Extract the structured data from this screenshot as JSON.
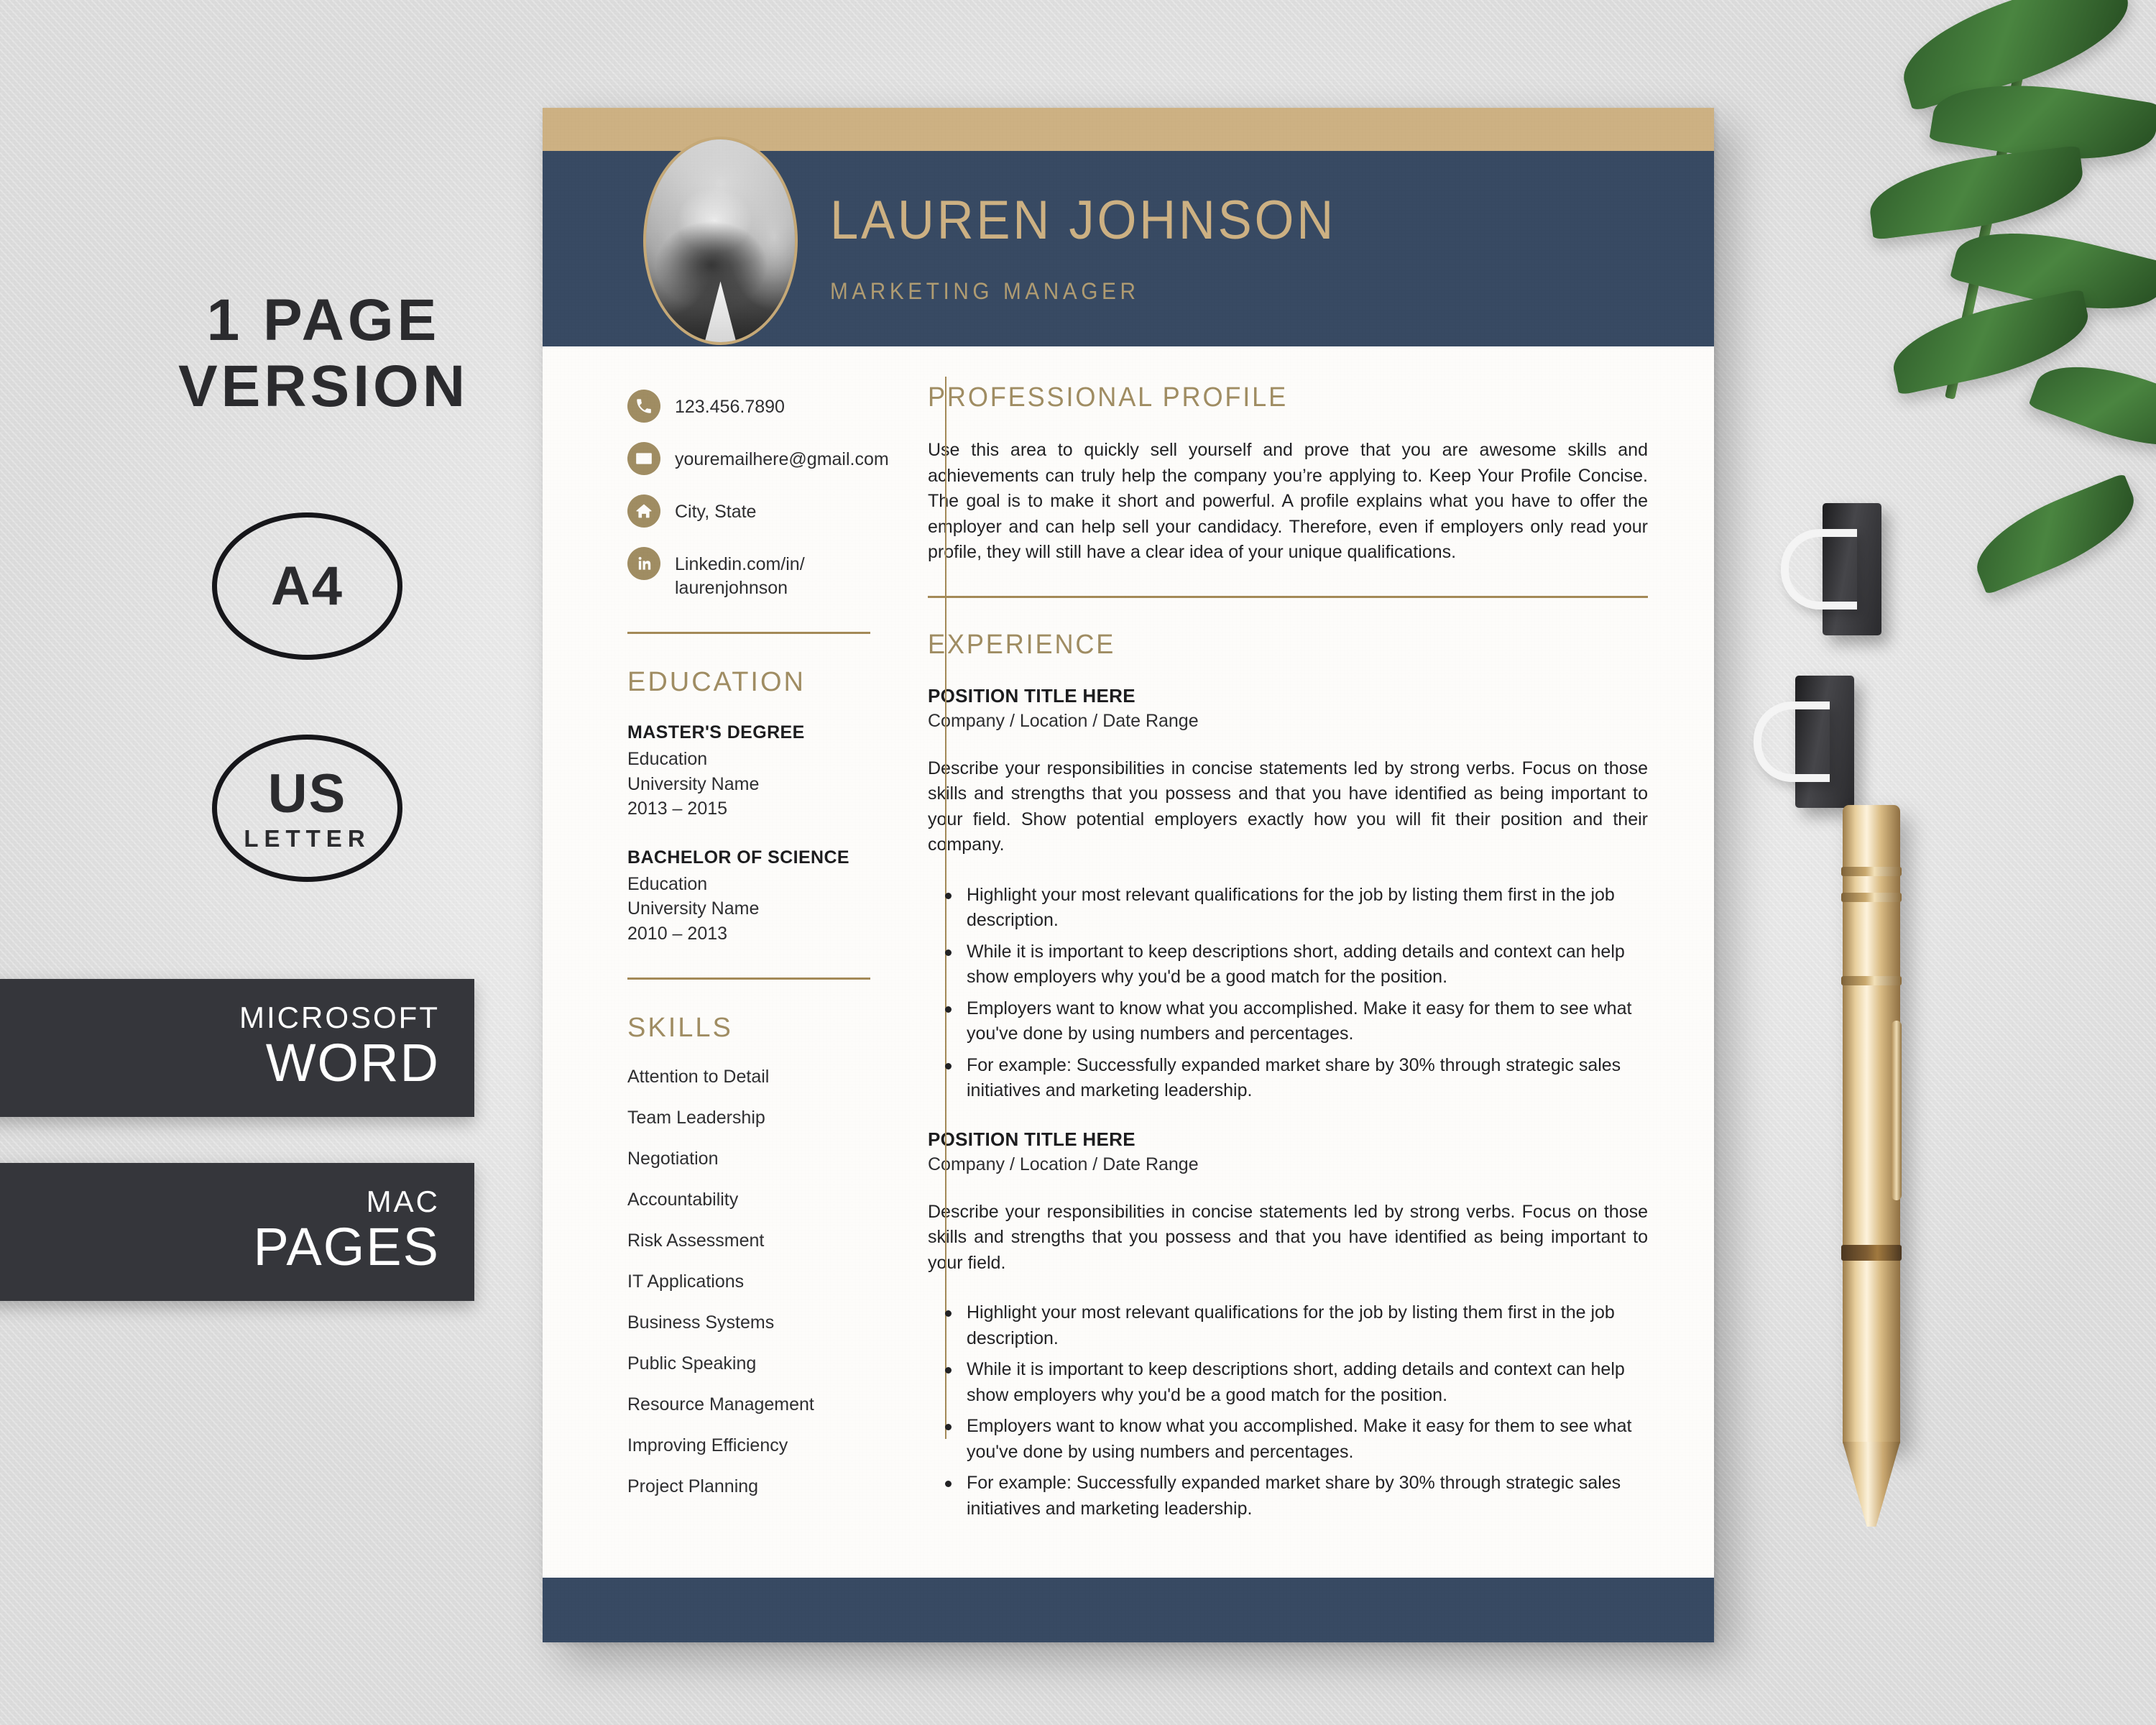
{
  "promo": {
    "title_line1": "1 PAGE",
    "title_line2": "VERSION",
    "badges": [
      {
        "main": "A4",
        "sub": ""
      },
      {
        "main": "US",
        "sub": "LETTER"
      }
    ],
    "format_boxes": [
      {
        "small": "MICROSOFT",
        "big": "WORD"
      },
      {
        "small": "MAC",
        "big": "PAGES"
      }
    ]
  },
  "resume": {
    "name": "LAUREN JOHNSON",
    "role": "MARKETING MANAGER",
    "contacts": [
      {
        "icon": "phone-icon",
        "text": "123.456.7890"
      },
      {
        "icon": "envelope-icon",
        "text": "youremailhere@gmail.com"
      },
      {
        "icon": "home-icon",
        "text": "City, State"
      },
      {
        "icon": "linkedin-icon",
        "text": "Linkedin.com/in/ laurenjohnson"
      }
    ],
    "profile": {
      "heading": "PROFESSIONAL PROFILE",
      "text": "Use this area to quickly sell yourself and prove that you are awesome skills and achievements can truly help the company you’re applying to. Keep Your Profile Concise. The goal is to make it short and powerful. A profile explains what you have to offer the employer and can help sell your candidacy. Therefore, even if employers only read your profile, they will still have a clear idea of your unique qualifications."
    },
    "education": {
      "heading": "EDUCATION",
      "items": [
        {
          "degree": "MASTER'S DEGREE",
          "field": "Education",
          "school": "University Name",
          "dates": "2013 – 2015"
        },
        {
          "degree": "BACHELOR OF SCIENCE",
          "field": "Education",
          "school": "University Name",
          "dates": "2010 – 2013"
        }
      ]
    },
    "skills": {
      "heading": "SKILLS",
      "items": [
        "Attention to Detail",
        "Team Leadership",
        "Negotiation",
        "Accountability",
        "Risk Assessment",
        "IT Applications",
        "Business Systems",
        "Public Speaking",
        "Resource Management",
        "Improving Efficiency",
        "Project Planning"
      ]
    },
    "experience": {
      "heading": "EXPERIENCE",
      "jobs": [
        {
          "title": "POSITION TITLE HERE",
          "meta": "Company / Location / Date Range",
          "description": "Describe your responsibilities in concise statements led by strong verbs. Focus on those skills and strengths that you possess and that you have identified as being important to your field. Show potential employers exactly how you will fit their position and their company.",
          "bullets": [
            "Highlight your most relevant qualifications for the job by listing them first in the job description.",
            "While it is important to keep descriptions short, adding details and context can help show employers why you'd be a good match for the position.",
            "Employers want to know what you accomplished. Make it easy for them to see what you've done by using numbers and percentages.",
            "For example: Successfully expanded market share by 30% through strategic sales initiatives and marketing leadership."
          ]
        },
        {
          "title": "POSITION TITLE HERE",
          "meta": "Company / Location / Date Range",
          "description": "Describe your responsibilities in concise statements led by strong verbs. Focus on those skills and strengths that you possess and that you have identified as being important to your field.",
          "bullets": [
            "Highlight your most relevant qualifications for the job by listing them first in the job description.",
            "While it is important to keep descriptions short, adding details and context can help show employers why you'd be a good match for the position.",
            "Employers want to know what you accomplished. Make it easy for them to see what you've done by using numbers and percentages.",
            "For example: Successfully expanded market share by 30% through strategic sales initiatives and marketing leadership."
          ]
        }
      ]
    }
  },
  "colors": {
    "gold": "#cdb183",
    "gold_dark": "#a08d63",
    "navy": "#384a63",
    "dark_box": "#35363b",
    "paper": "#fdfcfa",
    "rule": "#a48a58"
  }
}
